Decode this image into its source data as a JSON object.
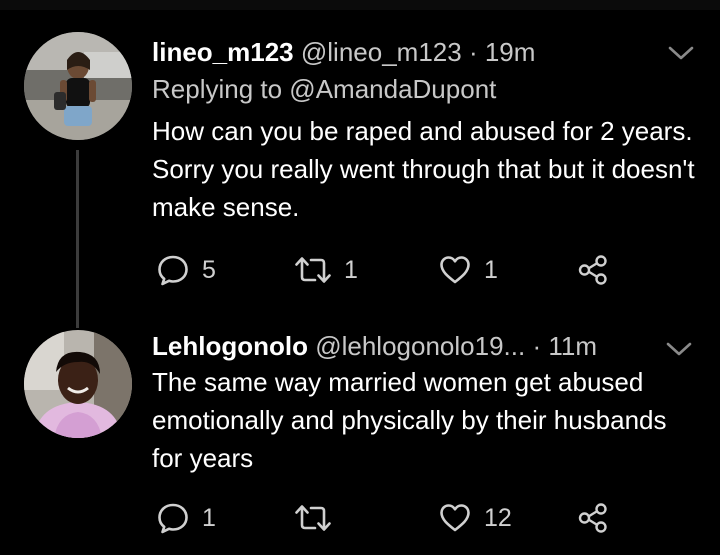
{
  "tweets": [
    {
      "name": "lineo_m123",
      "handle": "@lineo_m123",
      "separator": "·",
      "time": "19m",
      "replying_to": "Replying to @AmandaDupont",
      "text": "How can you be raped and abused for 2 years. Sorry you really went through that but it doesn't make sense.",
      "reply_count": "5",
      "retweet_count": "1",
      "like_count": "1"
    },
    {
      "name": "Lehlogonolo",
      "handle": "@lehlogonolo19...",
      "separator": "·",
      "time": "11m",
      "text": "The same way married women get abused emotionally and physically by their husbands for years",
      "reply_count": "1",
      "retweet_count": "",
      "like_count": "12"
    }
  ],
  "colors": {
    "background": "#000000",
    "text": "#ffffff",
    "secondary_text": "#c8c8c8",
    "thread_line": "#3c3c3c",
    "icon": "#d0d0d0"
  },
  "icons": [
    "reply-icon",
    "retweet-icon",
    "like-icon",
    "share-icon",
    "chevron-down-icon"
  ]
}
